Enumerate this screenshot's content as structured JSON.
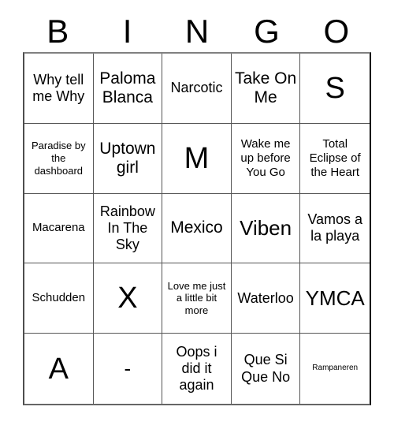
{
  "card": {
    "title": "BINGO",
    "header_letters": [
      "B",
      "I",
      "N",
      "G",
      "O"
    ],
    "colors": {
      "background": "#ffffff",
      "text": "#000000",
      "grid_line": "#555555",
      "outer_border": "#000000"
    },
    "grid": {
      "columns": 5,
      "rows": 5,
      "cells": [
        {
          "text": "Why tell me Why",
          "size": "md"
        },
        {
          "text": "Paloma Blanca",
          "size": "lg"
        },
        {
          "text": "Narcotic",
          "size": "md"
        },
        {
          "text": "Take On Me",
          "size": "lg"
        },
        {
          "text": "S",
          "size": "xxl"
        },
        {
          "text": "Paradise by the dashboard",
          "size": "xs"
        },
        {
          "text": "Uptown girl",
          "size": "lg"
        },
        {
          "text": "M",
          "size": "xxl"
        },
        {
          "text": "Wake me up before You Go",
          "size": "sm"
        },
        {
          "text": "Total Eclipse of the Heart",
          "size": "sm"
        },
        {
          "text": "Macarena",
          "size": "sm"
        },
        {
          "text": "Rainbow In The Sky",
          "size": "md"
        },
        {
          "text": "Mexico",
          "size": "lg"
        },
        {
          "text": "Viben",
          "size": "xl"
        },
        {
          "text": "Vamos a la playa",
          "size": "md"
        },
        {
          "text": "Schudden",
          "size": "sm"
        },
        {
          "text": "X",
          "size": "xxl"
        },
        {
          "text": "Love me just a little bit more",
          "size": "xs"
        },
        {
          "text": "Waterloo",
          "size": "md"
        },
        {
          "text": "YMCA",
          "size": "xl"
        },
        {
          "text": "A",
          "size": "xxl"
        },
        {
          "text": "-",
          "size": "xl"
        },
        {
          "text": "Oops i did it again",
          "size": "md"
        },
        {
          "text": "Que Si Que No",
          "size": "md"
        },
        {
          "text": "Rampaneren",
          "size": "xxs"
        }
      ]
    }
  }
}
